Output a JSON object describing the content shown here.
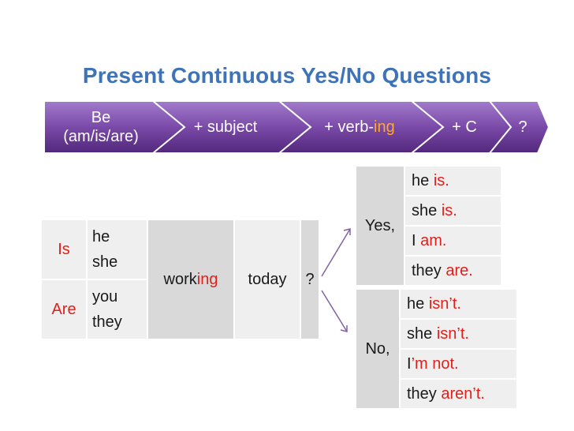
{
  "title": "Present Continuous Yes/No Questions",
  "process": [
    {
      "line1": "Be",
      "line2": "(am/is/are)"
    },
    {
      "pre": "+ subject"
    },
    {
      "pre": "+ verb-",
      "hl": "ing"
    },
    {
      "pre": "+ C"
    },
    {
      "pre": "?"
    }
  ],
  "main_table": {
    "rows": [
      {
        "aux": "Is",
        "subj1": "he",
        "subj2": "she"
      },
      {
        "aux": "Are",
        "subj1": "you",
        "subj2": "they"
      }
    ],
    "verb_base": "work",
    "verb_ending": "ing",
    "time": "today",
    "qmark": "?"
  },
  "yes_table": {
    "label": "Yes,",
    "rows": [
      {
        "subj": "he ",
        "verb": "is."
      },
      {
        "subj": "she ",
        "verb": "is."
      },
      {
        "subj": "I ",
        "verb": "am."
      },
      {
        "subj": "they ",
        "verb": "are."
      }
    ]
  },
  "no_table": {
    "label": "No,",
    "rows": [
      {
        "subj": "he ",
        "verb": "isn’t."
      },
      {
        "subj": "she ",
        "verb": "isn’t."
      },
      {
        "subj": "I",
        "verb": "’m not."
      },
      {
        "subj": "they ",
        "verb": "aren’t."
      }
    ]
  },
  "colors": {
    "title": "#3f73b8",
    "chevron_top": "#9b6cc4",
    "chevron_bottom": "#5b2f86",
    "highlight": "#ffa733",
    "red": "#e0201b",
    "arrow": "#8064a2"
  }
}
